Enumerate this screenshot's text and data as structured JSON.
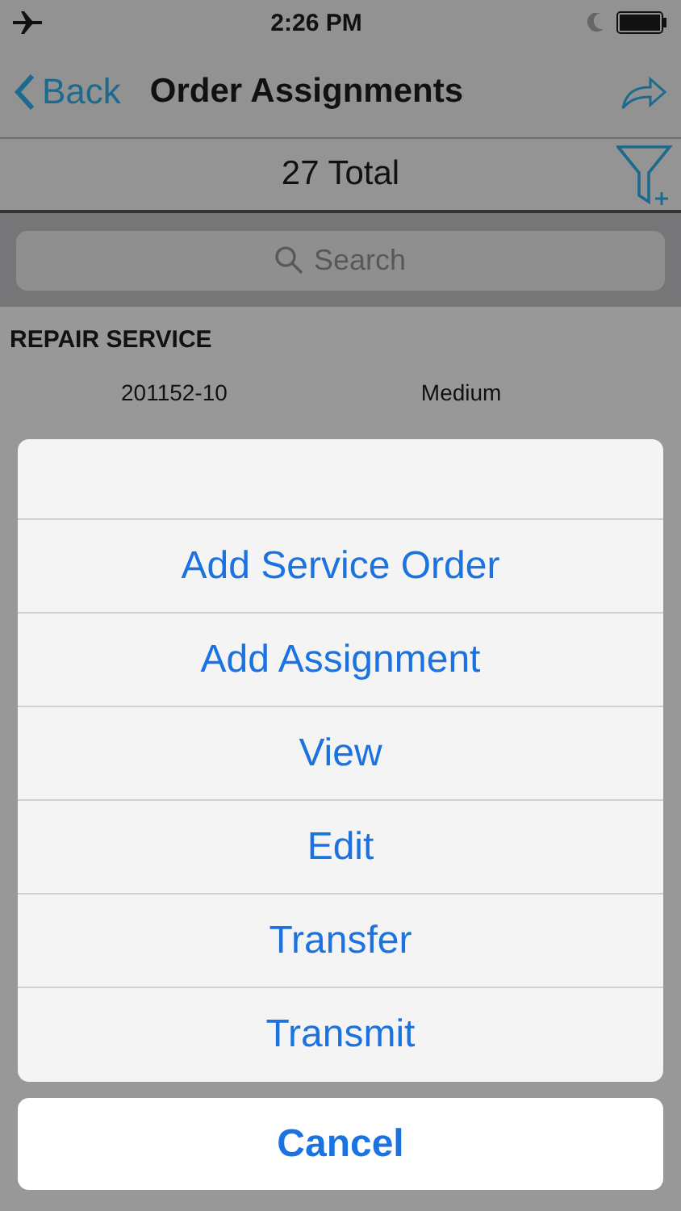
{
  "status_bar": {
    "time": "2:26 PM"
  },
  "nav_bar": {
    "back": "Back",
    "title": "Order Assignments"
  },
  "summary": {
    "total": "27 Total"
  },
  "search": {
    "placeholder": "Search"
  },
  "sections": [
    {
      "title": "REPAIR SERVICE",
      "rows": [
        {
          "number": "201152-10",
          "priority": "Medium"
        }
      ]
    }
  ],
  "action_sheet": {
    "actions": [
      {
        "label": "Add Service Order"
      },
      {
        "label": "Add Assignment"
      },
      {
        "label": "View"
      },
      {
        "label": "Edit"
      },
      {
        "label": "Transfer"
      },
      {
        "label": "Transmit"
      }
    ],
    "cancel": "Cancel"
  }
}
